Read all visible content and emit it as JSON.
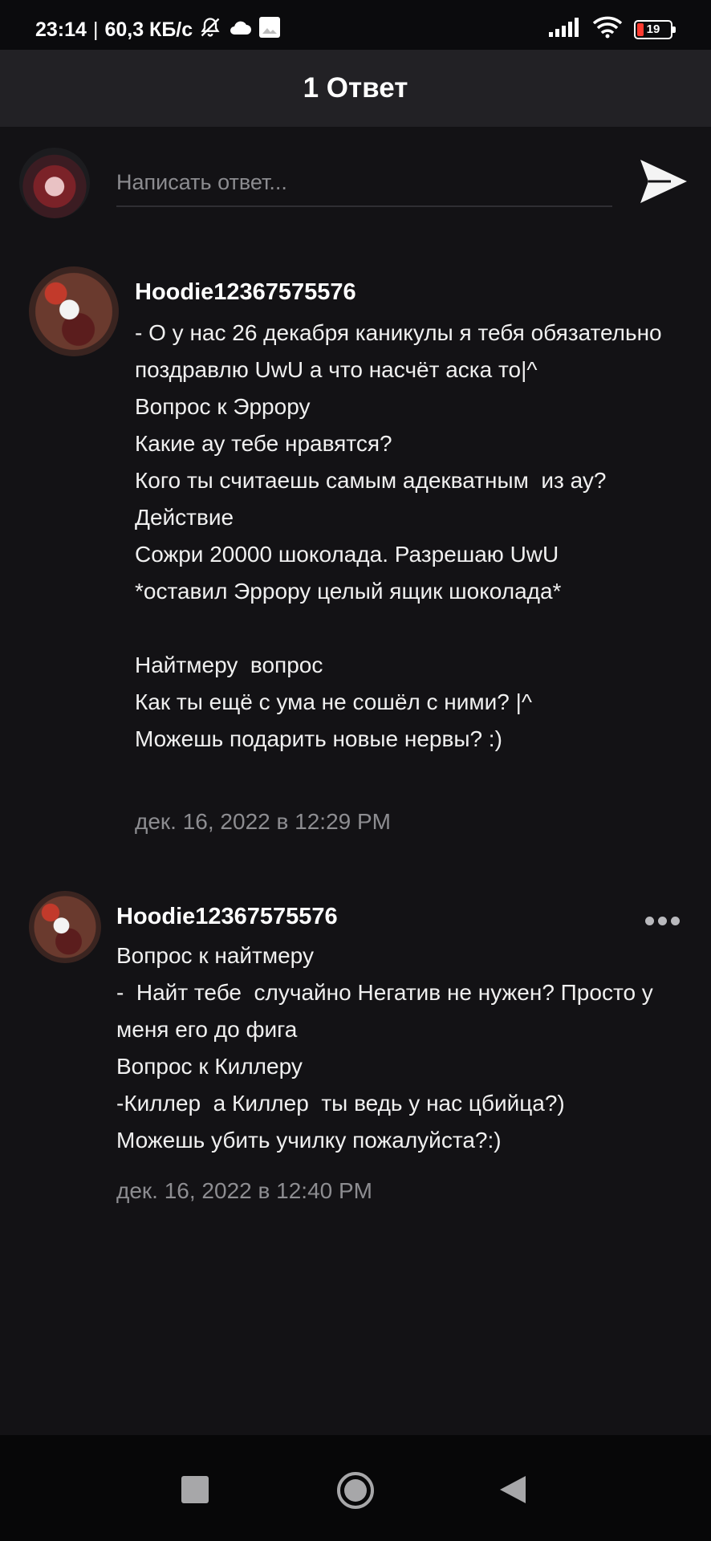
{
  "status_bar": {
    "time": "23:14",
    "network_speed": "60,3 КБ/с",
    "battery_level": "19",
    "icons": [
      "bell-off-icon",
      "cloud-icon",
      "image-icon",
      "signal-icon",
      "wifi-icon",
      "battery-icon"
    ]
  },
  "header": {
    "title": "1 Ответ"
  },
  "reply": {
    "placeholder": "Написать ответ...",
    "send_icon": "send-icon"
  },
  "comments": [
    {
      "username": "Hoodie12367575576",
      "text": "- О у нас 26 декабря каникулы я тебя обязательно поздравлю UwU а что насчёт аска то|^\nВопрос к Эррору\nКакие ау тебе нравятся?\nКого ты считаешь самым адекватным  из ау?\nДействие\nСожри 20000 шоколада. Разрешаю UwU\n*оставил Эррору целый ящик шоколада*\n\nНайтмеру  вопрос\nКак ты ещё с ума не сошёл с ними? |^\nМожешь подарить новые нервы? :)",
      "timestamp": "дек. 16, 2022 в 12:29 PM"
    },
    {
      "username": "Hoodie12367575576",
      "text": "Вопрос к найтмеру\n-  Найт тебе  случайно Негатив не нужен? Просто у меня его до фига\nВопрос к Киллеру\n-Киллер  а Киллер  ты ведь у нас цбийца?)\nМожешь убить училку пожалуйста?:)",
      "timestamp": "дек. 16, 2022 в 12:40 PM",
      "more_icon": "more-dots-icon"
    }
  ],
  "nav_bar": {
    "icons": [
      "recents-square-icon",
      "home-circle-icon",
      "back-triangle-icon"
    ]
  },
  "colors": {
    "background": "#131215",
    "header": "#222125",
    "timestamp": "#8d8d91",
    "battery_low": "#ff3b30"
  }
}
